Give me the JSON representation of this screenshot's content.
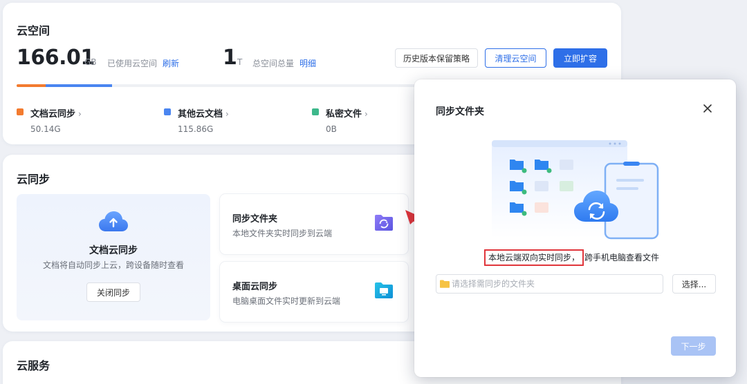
{
  "storage": {
    "title": "云空间",
    "used_value": "166.01",
    "used_unit": "GB",
    "used_label": "已使用云空间",
    "refresh_link": "刷新",
    "total_value": "1",
    "total_unit": "T",
    "total_label": "总空间总量",
    "detail_link": "明细",
    "buttons": {
      "history": "历史版本保留策略",
      "clean": "清理云空间",
      "expand": "立即扩容"
    },
    "usage_fractions": {
      "doc_sync": 0.049,
      "other_docs": 0.113
    },
    "legend": [
      {
        "label": "文档云同步",
        "value": "50.14G",
        "color": "#f37b2f"
      },
      {
        "label": "其他云文档",
        "value": "115.86G",
        "color": "#4a85f0"
      },
      {
        "label": "私密文件",
        "value": "0B",
        "color": "#3db88b"
      }
    ]
  },
  "sync": {
    "title": "云同步",
    "auto_sync": {
      "title": "文档云同步",
      "description": "文档将自动同步上云，跨设备随时查看",
      "button": "关闭同步"
    },
    "features": [
      {
        "title": "同步文件夹",
        "description": "本地文件夹实时同步到云端",
        "icon": "sync-folder-icon"
      },
      {
        "title": "桌面云同步",
        "description": "电脑桌面文件实时更新到云端",
        "icon": "desktop-sync-icon"
      }
    ]
  },
  "service": {
    "title": "云服务"
  },
  "dialog": {
    "title": "同步文件夹",
    "caption_highlight": "本地云端双向实时同步，",
    "caption_rest": "跨手机电脑查看文件",
    "input_placeholder": "请选择需同步的文件夹",
    "input_value": "",
    "choose_button": "选择...",
    "next_button": "下一步"
  },
  "colors": {
    "accent": "#2e6fe8",
    "highlight_border": "#e0353b",
    "arrow": "#e0353b"
  }
}
